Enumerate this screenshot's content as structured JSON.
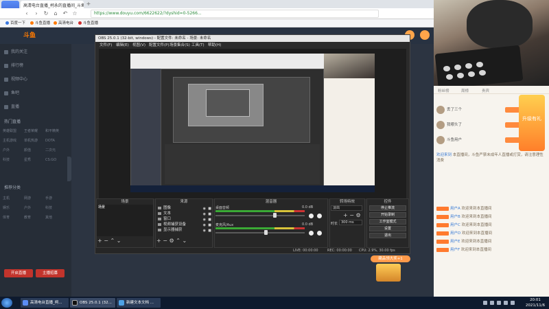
{
  "browser": {
    "tab_title": "高清电台直播_柯永的直播间_斗鱼直播",
    "url": "https://www.douyu.com/6622622/?dyshid=0-5266...",
    "bookmarks": [
      "百度一下",
      "斗鱼直播",
      "高清电台",
      "斗鱼直播"
    ]
  },
  "site": {
    "logo": "斗鱼",
    "sidebar_items": [
      "我的关注",
      "排行榜",
      "视频中心",
      "鱼吧",
      "直播"
    ],
    "sidebar_section_1": "热门直播",
    "sidebar_grid_1": [
      [
        "英雄联盟",
        "王者荣耀",
        "和平精英"
      ],
      [
        "主机游戏",
        "单机热游",
        "DOTA"
      ],
      [
        "户外",
        "颜值",
        "二次元"
      ],
      [
        "科技",
        "星秀",
        "CS:GO"
      ]
    ],
    "sidebar_section_2": "推荐分类",
    "sidebar_grid_2": [
      [
        "主机",
        "网游",
        "手游"
      ],
      [
        "娱乐",
        "户外",
        "科技"
      ],
      [
        "体育",
        "教育",
        "其他"
      ]
    ],
    "sidebar_buttons": [
      "开启直播",
      "主播招募"
    ]
  },
  "obs": {
    "title": "OBS 25.0.1 (32-bit, windows) - 配置文件: 未命名 - 场景: 未命名",
    "menu": [
      "文件(F)",
      "编辑(E)",
      "视图(V)",
      "配置文件(P)",
      "场景集合(S)",
      "工具(T)",
      "帮助(H)"
    ],
    "docks": {
      "scenes": "场景",
      "sources": "来源",
      "mixer": "混音器",
      "transitions": "转场特效",
      "controls": "控件"
    },
    "scene_list": [
      "场景"
    ],
    "sources": [
      "图像",
      "文本",
      "窗口",
      "视频捕获设备",
      "显示器捕获"
    ],
    "mixer_tracks": [
      {
        "name": "桌面音频",
        "db": "0.0 dB",
        "level": 0.66
      },
      {
        "name": "麦克风/Aux",
        "db": "0.0 dB",
        "level": 0.56
      }
    ],
    "transition": {
      "select": "淡出",
      "duration_label": "时长",
      "duration": "300 ms"
    },
    "controls": [
      "停止推流",
      "开始录制",
      "工作室模式",
      "设置",
      "退出"
    ],
    "status": {
      "live": "LIVE: 00:00:00",
      "rec": "REC: 00:00:00",
      "cpu": "CPU: 2.9%, 30.00 fps"
    }
  },
  "chat": {
    "tabs": [
      "粉丝榜",
      "周榜",
      "贵宾"
    ],
    "ranks": [
      "丢了三个",
      "我哪头了",
      "斗鱼用户"
    ],
    "promo": "升级有礼",
    "messages": [
      {
        "user": "欢迎来到",
        "text": "本直播间，斗鱼严禁未成年人直播或打赏，请注意理性消费"
      },
      {
        "user": "用户A",
        "text": "欢迎来到本直播间"
      },
      {
        "user": "用户B",
        "text": "欢迎来到本直播间"
      },
      {
        "user": "用户C",
        "text": "欢迎来到本直播间"
      },
      {
        "user": "用户D",
        "text": "欢迎来到本直播间"
      },
      {
        "user": "用户E",
        "text": "欢迎来到本直播间"
      },
      {
        "user": "用户F",
        "text": "欢迎来到本直播间"
      }
    ]
  },
  "gift_chest": "藏品领大奖+1",
  "taskbar": {
    "items": [
      "高清电台直播_柯...",
      "OBS 25.0.1 (32...",
      "新建文本文档 ..."
    ],
    "time": "20:01",
    "date": "2021/11/6"
  },
  "colors": {
    "accent": "#ff7a00",
    "obs_bg": "#2b2b2b",
    "site_dark": "#283241",
    "taskbar": "#0e1a2e"
  }
}
